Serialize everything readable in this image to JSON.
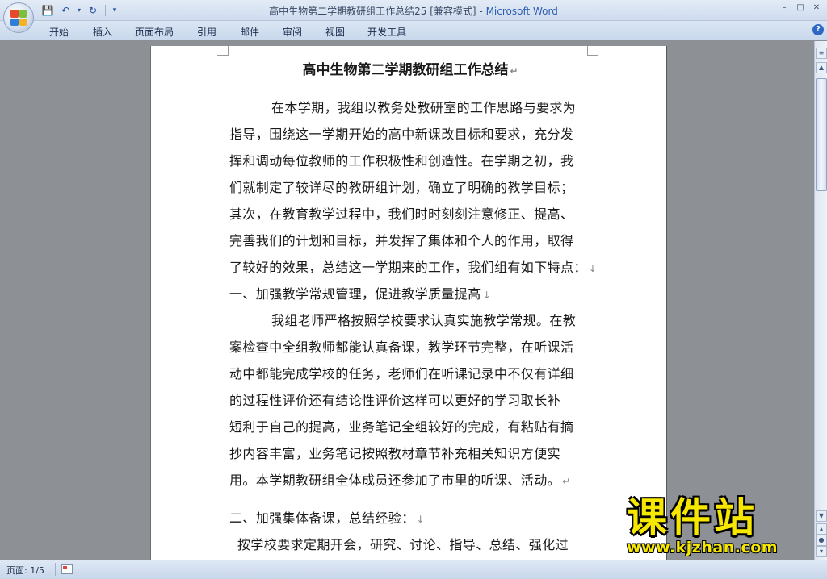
{
  "window": {
    "title": "高中生物第二学期教研组工作总结25 [兼容模式]",
    "app_name": "Microsoft Word",
    "separator": " - "
  },
  "ribbon": {
    "tabs": [
      "开始",
      "插入",
      "页面布局",
      "引用",
      "邮件",
      "审阅",
      "视图",
      "开发工具"
    ]
  },
  "document": {
    "title": "高中生物第二学期教研组工作总结",
    "lines": [
      "在本学期，我组以教务处教研室的工作思路与要求为",
      "指导，围绕这一学期开始的高中新课改目标和要求，充分发",
      "挥和调动每位教师的工作积极性和创造性。在学期之初，我",
      "们就制定了较详尽的教研组计划，确立了明确的教学目标；",
      "其次，在教育教学过程中，我们时时刻刻注意修正、提高、",
      "完善我们的计划和目标，并发挥了集体和个人的作用，取得",
      "了较好的效果，总结这一学期来的工作，我们组有如下特点：",
      "一、加强教学常规管理，促进教学质量提高",
      "我组老师严格按照学校要求认真实施教学常规。在教",
      "案检查中全组教师都能认真备课，教学环节完整，在听课活",
      "动中都能完成学校的任务，老师们在听课记录中不仅有详细",
      "的过程性评价还有结论性评价这样可以更好的学习取长补",
      "短利于自己的提高，业务笔记全组较好的完成，有粘贴有摘",
      "抄内容丰富，业务笔记按照教材章节补充相关知识方便实",
      "用。本学期教研组全体成员还参加了市里的听课、活动。",
      "二、加强集体备课，总结经验：",
      "按学校要求定期开会，研究、讨论、指导、总结、强化过"
    ],
    "paragraph_mark": "↵",
    "line_mark": "↓"
  },
  "statusbar": {
    "page": "页面: 1/5"
  },
  "watermark": {
    "title": "课件站",
    "url": "www.kjzhan.com"
  }
}
